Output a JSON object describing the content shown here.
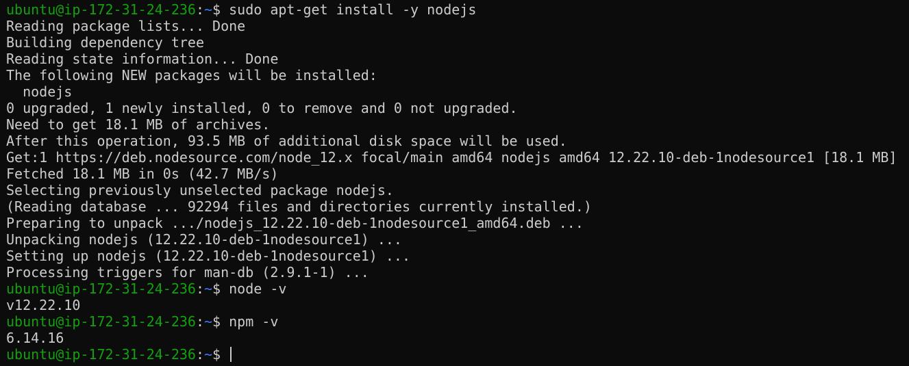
{
  "colors": {
    "background": "#0c0c0c",
    "text": "#cccccc",
    "prompt_user": "#13a10e",
    "prompt_path": "#3b78ff"
  },
  "prompt": {
    "user_host": "ubuntu@ip-172-31-24-236",
    "separator": ":",
    "path": "~",
    "symbol": "$"
  },
  "lines": [
    {
      "type": "prompt",
      "command": " sudo apt-get install -y nodejs"
    },
    {
      "type": "output",
      "text": "Reading package lists... Done"
    },
    {
      "type": "output",
      "text": "Building dependency tree"
    },
    {
      "type": "output",
      "text": "Reading state information... Done"
    },
    {
      "type": "output",
      "text": "The following NEW packages will be installed:"
    },
    {
      "type": "output",
      "text": "  nodejs"
    },
    {
      "type": "output",
      "text": "0 upgraded, 1 newly installed, 0 to remove and 0 not upgraded."
    },
    {
      "type": "output",
      "text": "Need to get 18.1 MB of archives."
    },
    {
      "type": "output",
      "text": "After this operation, 93.5 MB of additional disk space will be used."
    },
    {
      "type": "output",
      "text": "Get:1 https://deb.nodesource.com/node_12.x focal/main amd64 nodejs amd64 12.22.10-deb-1nodesource1 [18.1 MB]"
    },
    {
      "type": "output",
      "text": "Fetched 18.1 MB in 0s (42.7 MB/s)"
    },
    {
      "type": "output",
      "text": "Selecting previously unselected package nodejs."
    },
    {
      "type": "output",
      "text": "(Reading database ... 92294 files and directories currently installed.)"
    },
    {
      "type": "output",
      "text": "Preparing to unpack .../nodejs_12.22.10-deb-1nodesource1_amd64.deb ..."
    },
    {
      "type": "output",
      "text": "Unpacking nodejs (12.22.10-deb-1nodesource1) ..."
    },
    {
      "type": "output",
      "text": "Setting up nodejs (12.22.10-deb-1nodesource1) ..."
    },
    {
      "type": "output",
      "text": "Processing triggers for man-db (2.9.1-1) ..."
    },
    {
      "type": "prompt",
      "command": " node -v"
    },
    {
      "type": "output",
      "text": "v12.22.10"
    },
    {
      "type": "prompt",
      "command": " npm -v"
    },
    {
      "type": "output",
      "text": "6.14.16"
    },
    {
      "type": "prompt",
      "command": " ",
      "cursor": true
    }
  ]
}
